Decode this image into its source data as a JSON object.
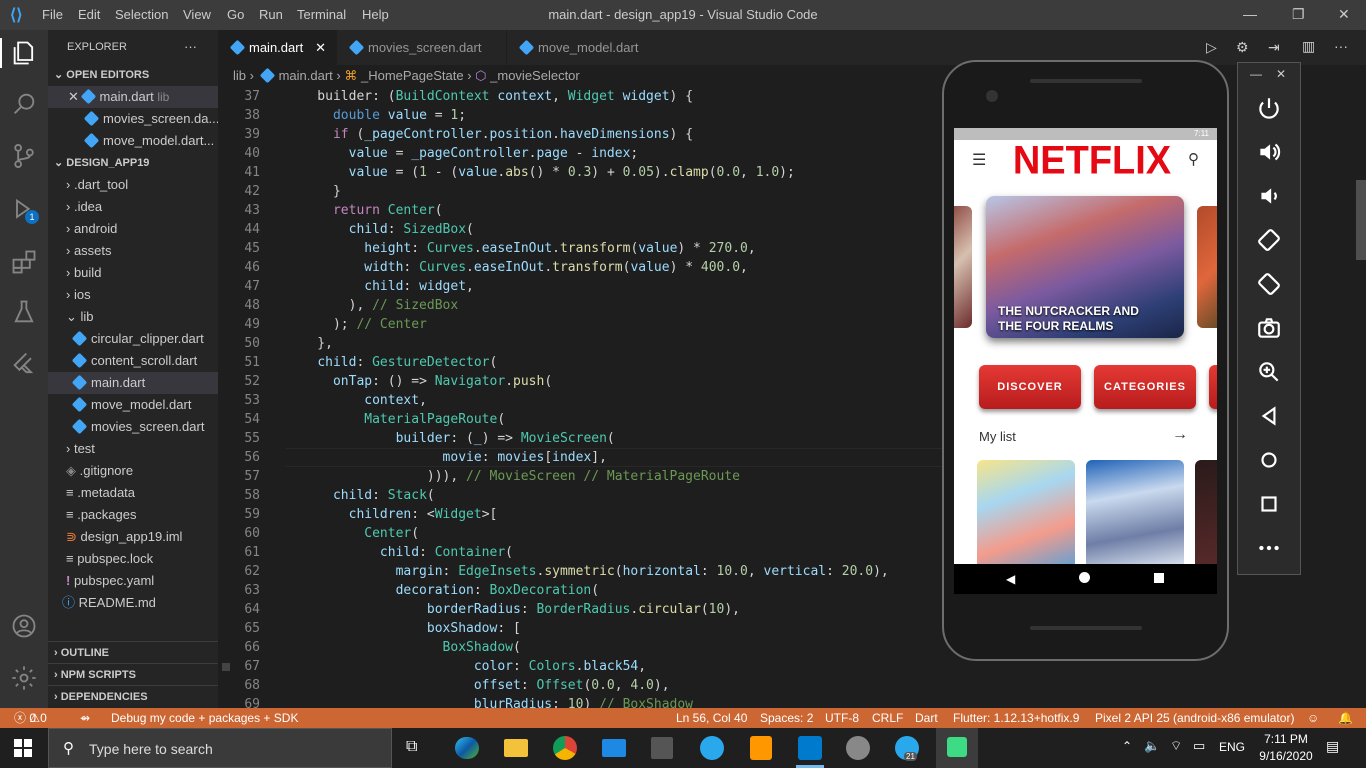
{
  "window": {
    "menu": [
      "File",
      "Edit",
      "Selection",
      "View",
      "Go",
      "Run",
      "Terminal",
      "Help"
    ],
    "title": "main.dart - design_app19 - Visual Studio Code"
  },
  "sidebar": {
    "header": "EXPLORER",
    "open_editors_label": "OPEN EDITORS",
    "open_editors": [
      {
        "name": "main.dart",
        "hint": "lib"
      },
      {
        "name": "movies_screen.da..."
      },
      {
        "name": "move_model.dart..."
      }
    ],
    "project_label": "DESIGN_APP19",
    "folders": [
      ".dart_tool",
      ".idea",
      "android",
      "assets",
      "build",
      "ios",
      "lib"
    ],
    "lib_files": [
      "circular_clipper.dart",
      "content_scroll.dart",
      "main.dart",
      "move_model.dart",
      "movies_screen.dart"
    ],
    "after": [
      "test"
    ],
    "files": [
      ".gitignore",
      ".metadata",
      ".packages",
      "design_app19.iml",
      "pubspec.lock",
      "pubspec.yaml",
      "README.md"
    ],
    "sections": [
      "OUTLINE",
      "NPM SCRIPTS",
      "DEPENDENCIES"
    ]
  },
  "tabs": [
    "main.dart",
    "movies_screen.dart",
    "move_model.dart"
  ],
  "breadcrumb": {
    "a": "lib",
    "b": "main.dart",
    "c": "_HomePageState",
    "d": "_movieSelector"
  },
  "code_lines": [
    {
      "n": "37",
      "html": "    builder: (<span class='t'>BuildContext</span> <span class='v'>context</span>, <span class='t'>Widget</span> <span class='v'>widget</span>) {"
    },
    {
      "n": "38",
      "html": "      <span class='k'>double</span> <span class='v'>value</span> = <span class='n'>1</span>;"
    },
    {
      "n": "39",
      "html": "      <span class='c2'>if</span> (<span class='v'>_pageController</span>.<span class='v'>position</span>.<span class='v'>haveDimensions</span>) {"
    },
    {
      "n": "40",
      "html": "        <span class='v'>value</span> = <span class='v'>_pageController</span>.<span class='v'>page</span> - <span class='v'>index</span>;"
    },
    {
      "n": "41",
      "html": "        <span class='v'>value</span> = (<span class='n'>1</span> - (<span class='v'>value</span>.<span class='f'>abs</span>() * <span class='n'>0.3</span>) + <span class='n'>0.05</span>).<span class='f'>clamp</span>(<span class='n'>0.0</span>, <span class='n'>1.0</span>);"
    },
    {
      "n": "42",
      "html": "      }"
    },
    {
      "n": "43",
      "html": "      <span class='c2'>return</span> <span class='t'>Center</span>("
    },
    {
      "n": "44",
      "html": "        <span class='v'>child</span>: <span class='t'>SizedBox</span>("
    },
    {
      "n": "45",
      "html": "          <span class='v'>height</span>: <span class='t'>Curves</span>.<span class='v'>easeInOut</span>.<span class='f'>transform</span>(<span class='v'>value</span>) * <span class='n'>270.0</span>,"
    },
    {
      "n": "46",
      "html": "          <span class='v'>width</span>: <span class='t'>Curves</span>.<span class='v'>easeInOut</span>.<span class='f'>transform</span>(<span class='v'>value</span>) * <span class='n'>400.0</span>,"
    },
    {
      "n": "47",
      "html": "          <span class='v'>child</span>: <span class='v'>widget</span>,"
    },
    {
      "n": "48",
      "html": "        ), <span class='cm'>// SizedBox</span>"
    },
    {
      "n": "49",
      "html": "      ); <span class='cm'>// Center</span>"
    },
    {
      "n": "50",
      "html": "    },"
    },
    {
      "n": "51",
      "html": "    <span class='v'>child</span>: <span class='t'>GestureDetector</span>("
    },
    {
      "n": "52",
      "html": "      <span class='v'>onTap</span>: () =&gt; <span class='t'>Navigator</span>.<span class='f'>push</span>("
    },
    {
      "n": "53",
      "html": "          <span class='v'>context</span>,"
    },
    {
      "n": "54",
      "html": "          <span class='t'>MaterialPageRoute</span>("
    },
    {
      "n": "55",
      "html": "              <span class='v'>builder</span>: (<span class='v'>_</span>) =&gt; <span class='t'>MovieScreen</span>("
    },
    {
      "n": "56",
      "html": "                    <span class='v'>movie</span>: <span class='v'>movies</span>[<span class='v'>index</span>],"
    },
    {
      "n": "57",
      "html": "                  ))), <span class='cm'>// MovieScreen // MaterialPageRoute</span>"
    },
    {
      "n": "58",
      "html": "      <span class='v'>child</span>: <span class='t'>Stack</span>("
    },
    {
      "n": "59",
      "html": "        <span class='v'>children</span>: &lt;<span class='t'>Widget</span>&gt;["
    },
    {
      "n": "60",
      "html": "          <span class='t'>Center</span>("
    },
    {
      "n": "61",
      "html": "            <span class='v'>child</span>: <span class='t'>Container</span>("
    },
    {
      "n": "62",
      "html": "              <span class='v'>margin</span>: <span class='t'>EdgeInsets</span>.<span class='f'>symmetric</span>(<span class='v'>horizontal</span>: <span class='n'>10.0</span>, <span class='v'>vertical</span>: <span class='n'>20.0</span>),"
    },
    {
      "n": "63",
      "html": "              <span class='v'>decoration</span>: <span class='t'>BoxDecoration</span>("
    },
    {
      "n": "64",
      "html": "                  <span class='v'>borderRadius</span>: <span class='t'>BorderRadius</span>.<span class='f'>circular</span>(<span class='n'>10</span>),"
    },
    {
      "n": "65",
      "html": "                  <span class='v'>boxShadow</span>: ["
    },
    {
      "n": "66",
      "html": "                    <span class='t'>BoxShadow</span>("
    },
    {
      "n": "67",
      "html": "                        <span class='v'>color</span>: <span class='t'>Colors</span>.<span class='v'>black54</span>,"
    },
    {
      "n": "68",
      "html": "                        <span class='v'>offset</span>: <span class='t'>Offset</span>(<span class='n'>0.0</span>, <span class='n'>4.0</span>),"
    },
    {
      "n": "69",
      "html": "                        <span class='v'>blurRadius</span>: <span class='n'>10</span>) <span class='cm'>// BoxShadow</span>"
    }
  ],
  "status": {
    "errors": "0",
    "warnings": "0",
    "debug": "Debug my code + packages + SDK",
    "position": "Ln 56, Col 40",
    "spaces": "Spaces: 2",
    "encoding": "UTF-8",
    "eol": "CRLF",
    "lang": "Dart",
    "flutter": "Flutter: 1.12.13+hotfix.9",
    "device": "Pixel 2 API 25 (android-x86 emulator)"
  },
  "app": {
    "status_time": "7:11",
    "brand": "NETFLIX",
    "featured_title": "THE NUTCRACKER AND THE FOUR REALMS",
    "buttons": [
      "DISCOVER",
      "CATEGORIES"
    ],
    "list_title": "My list",
    "accent": "#e50914"
  },
  "taskbar": {
    "search_placeholder": "Type here to search",
    "lang": "ENG",
    "time": "7:11 PM",
    "date": "9/16/2020",
    "notif_count": "21"
  }
}
